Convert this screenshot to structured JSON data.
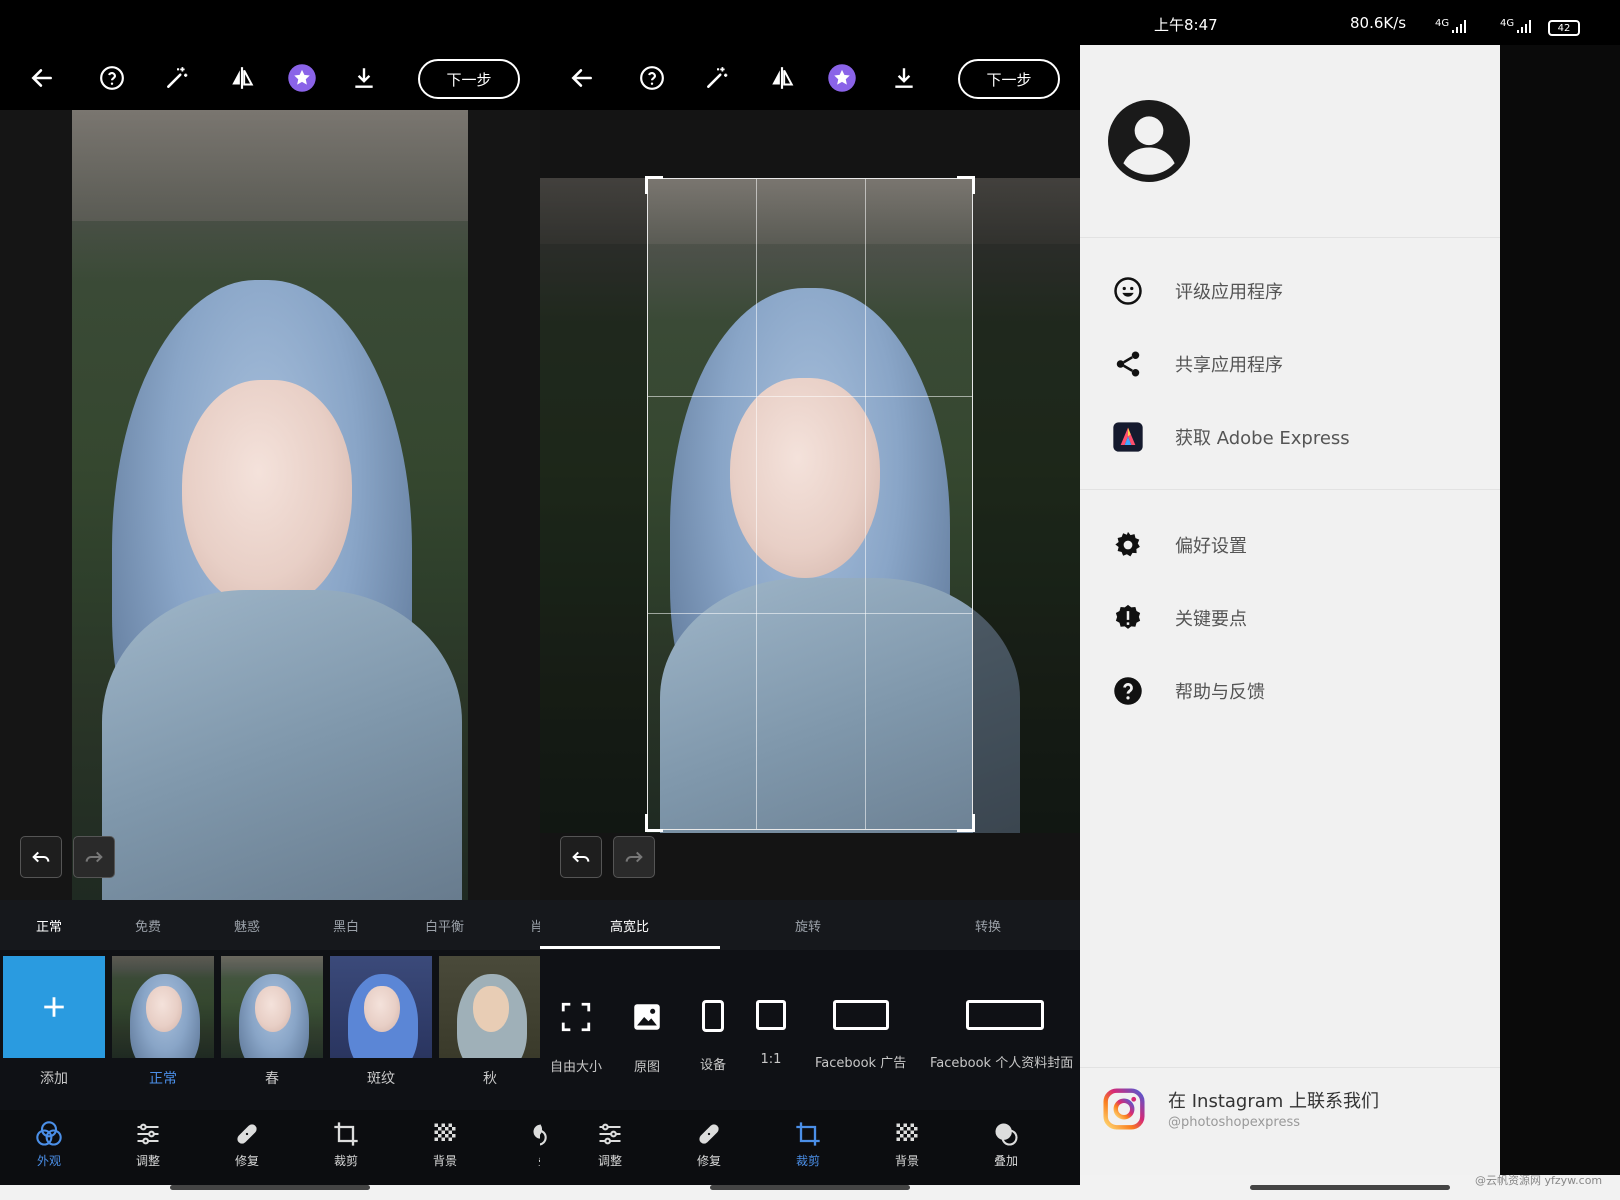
{
  "left_panel": {
    "next_label": "下一步",
    "filter_tabs": [
      "正常",
      "免费",
      "魅惑",
      "黑白",
      "白平衡",
      "肖"
    ],
    "thumbs": [
      {
        "label": "添加"
      },
      {
        "label": "正常"
      },
      {
        "label": "春"
      },
      {
        "label": "斑纹"
      },
      {
        "label": "秋"
      }
    ],
    "tools": [
      {
        "label": "外观",
        "icon": "looks-icon"
      },
      {
        "label": "调整",
        "icon": "sliders-icon"
      },
      {
        "label": "修复",
        "icon": "bandage-icon"
      },
      {
        "label": "裁剪",
        "icon": "crop-icon"
      },
      {
        "label": "背景",
        "icon": "background-icon"
      },
      {
        "label": "叠",
        "icon": "overlay-icon"
      }
    ]
  },
  "middle_panel": {
    "next_label": "下一步",
    "crop_tabs": [
      "高宽比",
      "旋转",
      "转换"
    ],
    "aspect_options": [
      {
        "label": "自由大小",
        "icon": "free-size-icon"
      },
      {
        "label": "原图",
        "icon": "original-image-icon"
      },
      {
        "label": "设备",
        "icon": "device-icon"
      },
      {
        "label": "1:1",
        "icon": "square-icon"
      },
      {
        "label": "Facebook 广告",
        "icon": "facebook-ad-icon"
      },
      {
        "label": "Facebook 个人资料封面",
        "icon": "facebook-cover-icon"
      }
    ],
    "tools": [
      {
        "label": "调",
        "icon": "looks-icon"
      },
      {
        "label": "调整",
        "icon": "sliders-icon"
      },
      {
        "label": "修复",
        "icon": "bandage-icon"
      },
      {
        "label": "裁剪",
        "icon": "crop-icon"
      },
      {
        "label": "背景",
        "icon": "background-icon"
      },
      {
        "label": "叠加",
        "icon": "overlay-icon"
      }
    ]
  },
  "right_panel": {
    "status": {
      "time": "上午8:47",
      "network_speed": "80.6K/s",
      "network_1": "4G",
      "network_2": "4G",
      "battery": "42"
    },
    "menu_items": [
      {
        "label": "评级应用程序",
        "icon": "smile-icon"
      },
      {
        "label": "共享应用程序",
        "icon": "share-icon"
      },
      {
        "label": "获取 Adobe Express",
        "icon": "adobe-express-icon"
      },
      {
        "label": "偏好设置",
        "icon": "gear-icon"
      },
      {
        "label": "关键要点",
        "icon": "alert-badge-icon"
      },
      {
        "label": "帮助与反馈",
        "icon": "help-icon"
      }
    ],
    "instagram": {
      "title": "在 Instagram 上联系我们",
      "handle": "@photoshopexpress"
    }
  },
  "watermark": "@云帆资源网 yfzyw.com",
  "colors": {
    "accent_blue": "#4b8fe8",
    "add_tile": "#2a9be0",
    "premium_purple": "#8a63e8"
  }
}
